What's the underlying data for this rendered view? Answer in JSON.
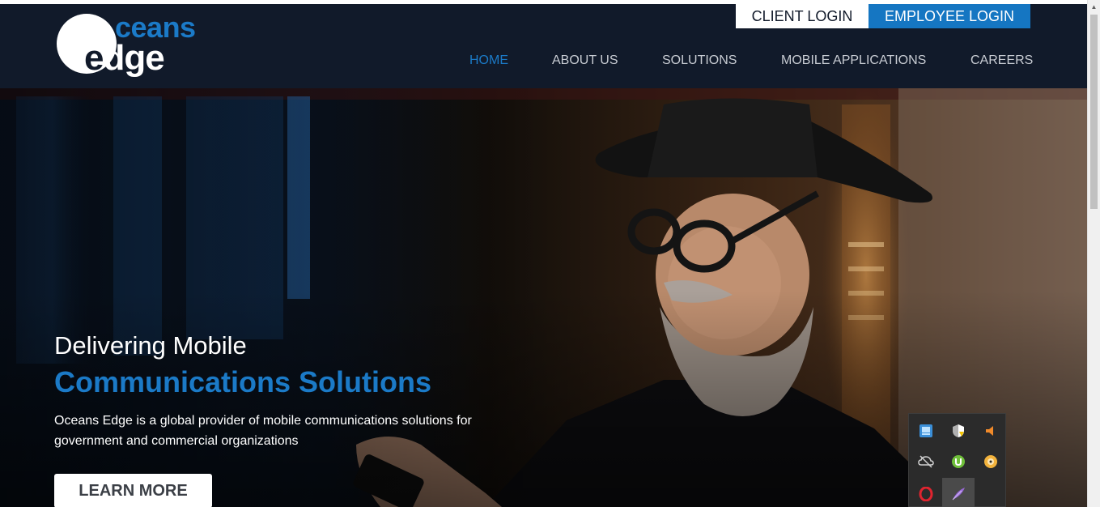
{
  "header": {
    "logo": {
      "text_top": "ceans",
      "text_bottom_first": "e",
      "text_bottom_rest": "dge",
      "brand_name": "Oceans Edge"
    },
    "client_login": "CLIENT LOGIN",
    "employee_login": "EMPLOYEE LOGIN",
    "nav": [
      {
        "label": "HOME",
        "active": true
      },
      {
        "label": "ABOUT US",
        "active": false
      },
      {
        "label": "SOLUTIONS",
        "active": false
      },
      {
        "label": "MOBILE APPLICATIONS",
        "active": false
      },
      {
        "label": "CAREERS",
        "active": false
      }
    ]
  },
  "hero": {
    "heading_line1": "Delivering Mobile",
    "heading_line2": "Communications Solutions",
    "description": "Oceans Edge is a global provider of mobile communications solutions for government and commercial organizations",
    "cta": "LEARN MORE"
  },
  "tray": {
    "icons": [
      "network-app-icon",
      "security-shield-icon",
      "speaker-muted-icon",
      "cloud-offline-icon",
      "utorrent-icon",
      "cd-disc-icon",
      "opera-icon",
      "feather-pen-icon"
    ]
  },
  "colors": {
    "header_bg": "#111a2a",
    "accent_blue": "#1b7ac7",
    "button_blue": "#1576c2"
  }
}
